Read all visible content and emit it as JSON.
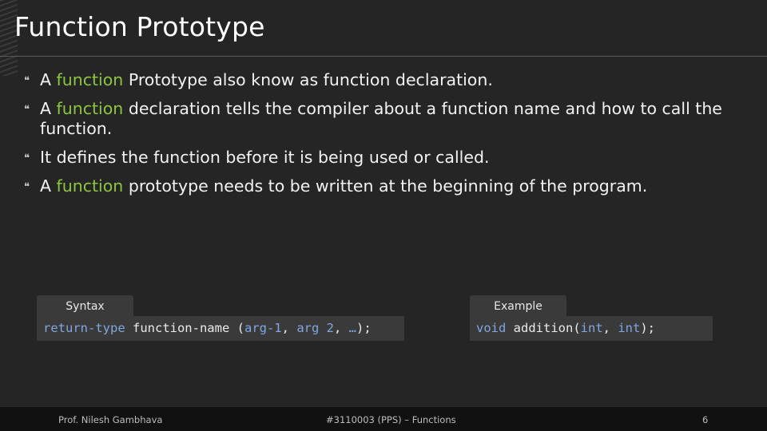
{
  "slide": {
    "title": "Function Prototype",
    "bullet_glyph": "❝",
    "bullets": [
      {
        "pre": "A ",
        "hl": "function",
        "post": " Prototype also know as function declaration."
      },
      {
        "pre": "A ",
        "hl": "function",
        "post": " declaration tells the compiler about a function name and how to call the function."
      },
      {
        "pre": "",
        "hl": "",
        "post": "It defines the function before it is being used or called."
      },
      {
        "pre": "A ",
        "hl": "function",
        "post": " prototype needs to be written at the beginning of the program."
      }
    ],
    "accent_color": "#8cc63f",
    "keyword_color": "#7fa7e0"
  },
  "syntax": {
    "tab_label": "Syntax",
    "code": {
      "return_type": "return-type",
      "name": " function-name ",
      "open": "(",
      "arg1": "arg-1",
      "comma1": ", ",
      "arg2": "arg 2",
      "comma2": ", ",
      "ellipsis": "…",
      "close": ");"
    }
  },
  "example": {
    "tab_label": "Example",
    "code": {
      "type": "void",
      "name": " addition(",
      "t1": "int",
      "comma": ", ",
      "t2": "int",
      "close": ");"
    }
  },
  "footer": {
    "author": "Prof. Nilesh Gambhava",
    "course": "#3110003 (PPS) – Functions",
    "page": "6"
  }
}
